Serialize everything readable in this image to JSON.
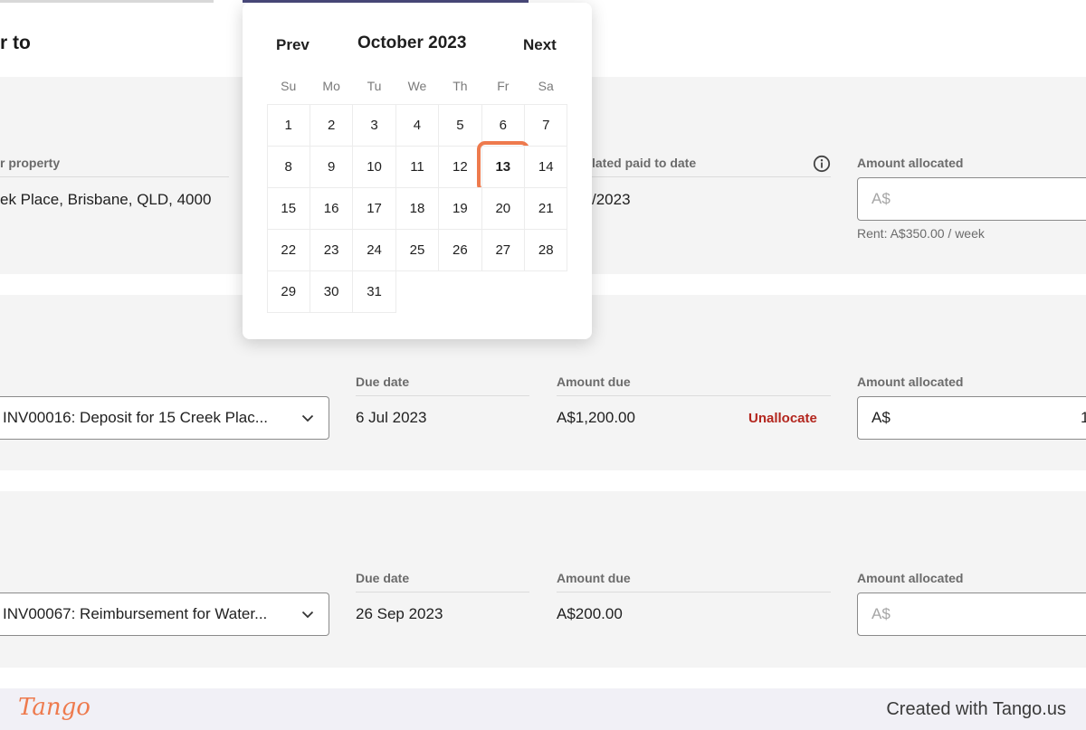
{
  "page": {
    "title": "r to"
  },
  "calendar": {
    "prev_label": "Prev",
    "next_label": "Next",
    "month_label": "October 2023",
    "weekdays": [
      "Su",
      "Mo",
      "Tu",
      "We",
      "Th",
      "Fr",
      "Sa"
    ],
    "start_offset": 0,
    "days": [
      "1",
      "2",
      "3",
      "4",
      "5",
      "6",
      "7",
      "8",
      "9",
      "10",
      "11",
      "12",
      "13",
      "14",
      "15",
      "16",
      "17",
      "18",
      "19",
      "20",
      "21",
      "22",
      "23",
      "24",
      "25",
      "26",
      "27",
      "28",
      "29",
      "30",
      "31"
    ],
    "selected_day": "13"
  },
  "rent_row": {
    "property_label": "r property",
    "property_value": "ek Place, Brisbane, QLD, 4000",
    "paid_to_label": "lated paid to date",
    "paid_to_value": "/2023",
    "amount_label": "Amount allocated",
    "amount_placeholder": "A$",
    "rent_hint": "Rent: A$350.00 / week"
  },
  "invoice_rows": [
    {
      "invoice": "INV00016: Deposit for 15 Creek Plac...",
      "due_label": "Due date",
      "due_value": "6 Jul 2023",
      "amount_due_label": "Amount due",
      "amount_due_value": "A$1,200.00",
      "action_label": "Unallocate",
      "amount_label": "Amount allocated",
      "amount_value": "A$",
      "amount_extra": "1"
    },
    {
      "invoice": "INV00067: Reimbursement for Water...",
      "due_label": "Due date",
      "due_value": "26 Sep 2023",
      "amount_due_label": "Amount due",
      "amount_due_value": "A$200.00",
      "amount_label": "Amount allocated",
      "amount_placeholder": "A$"
    }
  ],
  "footer": {
    "logo_text": "Tango",
    "created_text": "Created with Tango.us"
  },
  "colors": {
    "highlight": "#ee7a4d",
    "danger": "#b3261e",
    "brand": "#ee7a4d"
  }
}
